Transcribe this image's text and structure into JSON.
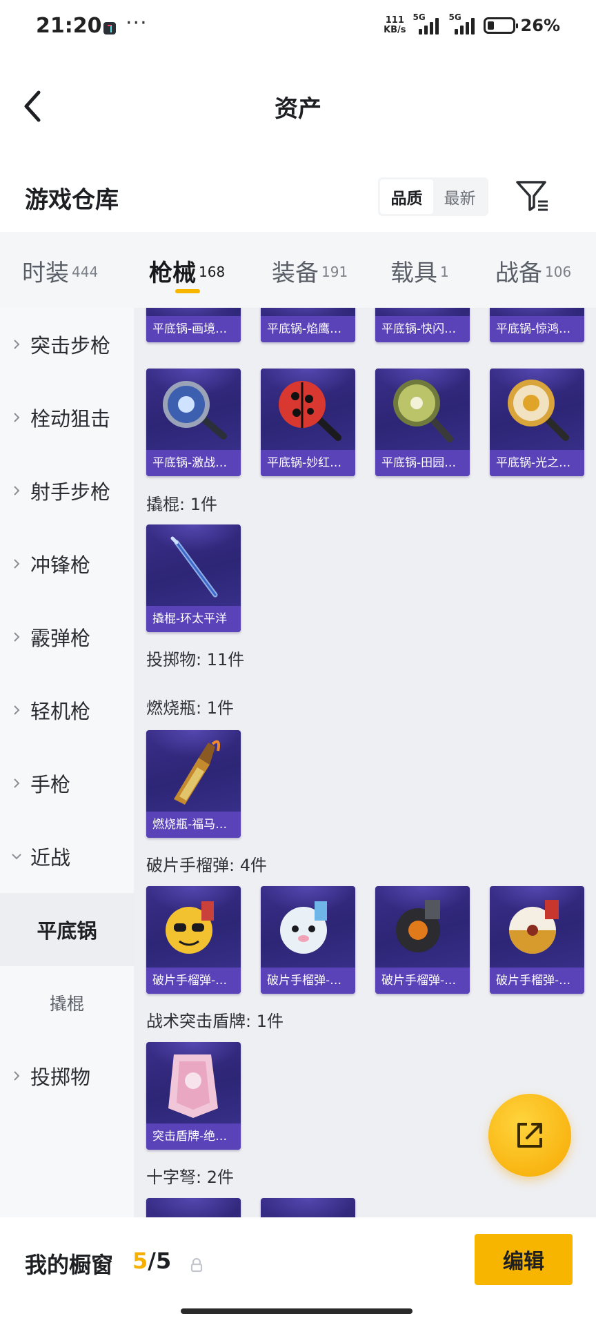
{
  "status_bar": {
    "time": "21:20",
    "dots": "···",
    "speed_value": "111",
    "speed_unit": "KB/s",
    "signal1": "5G",
    "signal2": "5G",
    "battery_pct": "26%",
    "battery_level": 0.26
  },
  "header": {
    "title": "资产"
  },
  "warehouse": {
    "title": "游戏仓库",
    "sort_options": [
      "品质",
      "最新"
    ],
    "sort_active": "品质"
  },
  "tabs": [
    {
      "label": "时装",
      "count": "444"
    },
    {
      "label": "枪械",
      "count": "168",
      "active": true
    },
    {
      "label": "装备",
      "count": "191"
    },
    {
      "label": "载具",
      "count": "1"
    },
    {
      "label": "战备",
      "count": "106"
    }
  ],
  "sidebar": [
    {
      "label": "突击步枪"
    },
    {
      "label": "栓动狙击"
    },
    {
      "label": "射手步枪"
    },
    {
      "label": "冲锋枪"
    },
    {
      "label": "霰弹枪"
    },
    {
      "label": "轻机枪"
    },
    {
      "label": "手枪"
    },
    {
      "label": "近战",
      "expanded": true
    },
    {
      "label": "平底锅",
      "selected": true
    },
    {
      "label": "撬棍",
      "sub": true
    },
    {
      "label": "投掷物"
    }
  ],
  "content": {
    "row_top": [
      "平底锅-画境…",
      "平底锅-焰鹰…",
      "平底锅-快闪…",
      "平底锅-惊鸿…"
    ],
    "row_pans": [
      "平底锅-激战…",
      "平底锅-妙红…",
      "平底锅-田园…",
      "平底锅-光之…"
    ],
    "crowbar_label": "撬棍: 1件",
    "crowbar_items": [
      "撬棍-环太平洋"
    ],
    "throwables_label": "投掷物: 11件",
    "molotov_label": "燃烧瓶: 1件",
    "molotov_items": [
      "燃烧瓶-福马…"
    ],
    "frag_label": "破片手榴弹: 4件",
    "frag_items": [
      "破片手榴弹-…",
      "破片手榴弹-…",
      "破片手榴弹-…",
      "破片手榴弹-…"
    ],
    "shield_label": "战术突击盾牌: 1件",
    "shield_items": [
      "突击盾牌-绝…"
    ],
    "crossbow_label": "十字弩: 2件"
  },
  "bottom_bar": {
    "title": "我的橱窗",
    "current": "5",
    "separator": "/",
    "max": "5",
    "edit_label": "编辑"
  },
  "colors": {
    "accent": "#f7b500",
    "card_bg": "#2d2575",
    "card_caption": "#5a42b8"
  }
}
